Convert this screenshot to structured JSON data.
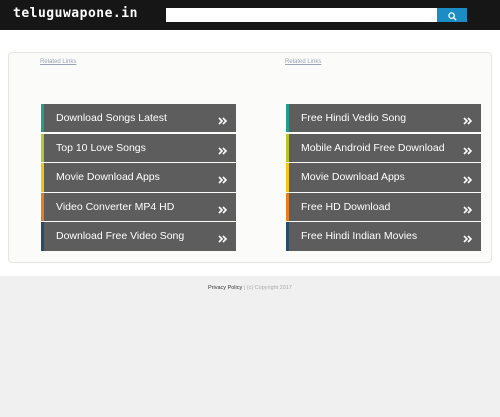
{
  "header": {
    "logo": "teluguwapone.in",
    "search_placeholder": ""
  },
  "columns": [
    {
      "title": "Related Links",
      "items": [
        {
          "label": "Download Songs Latest",
          "color": "#20a08a"
        },
        {
          "label": "Top 10 Love Songs",
          "color": "#b5c82a"
        },
        {
          "label": "Movie Download Apps",
          "color": "#f1c40f"
        },
        {
          "label": "Video Converter MP4 HD",
          "color": "#e67e22"
        },
        {
          "label": "Download Free Video Song",
          "color": "#2a4d66"
        }
      ]
    },
    {
      "title": "Related Links",
      "items": [
        {
          "label": "Free Hindi Vedio Song",
          "color": "#20a08a"
        },
        {
          "label": "Mobile Android Free Download",
          "color": "#b5c82a"
        },
        {
          "label": "Movie Download Apps",
          "color": "#f1c40f"
        },
        {
          "label": "Free HD Download",
          "color": "#e67e22"
        },
        {
          "label": "Free Hindi Indian Movies",
          "color": "#2a4d66"
        }
      ]
    }
  ],
  "footer": {
    "privacy": "Privacy Policy",
    "copyright": "| (c) Copyright 2017"
  },
  "colors": {
    "topbar": "#161616",
    "search_button": "#1c8dc4",
    "item_bg": "#5d5d5d"
  },
  "icons": {
    "search": "search-icon",
    "item_arrow": "double-chevron-right-icon"
  }
}
